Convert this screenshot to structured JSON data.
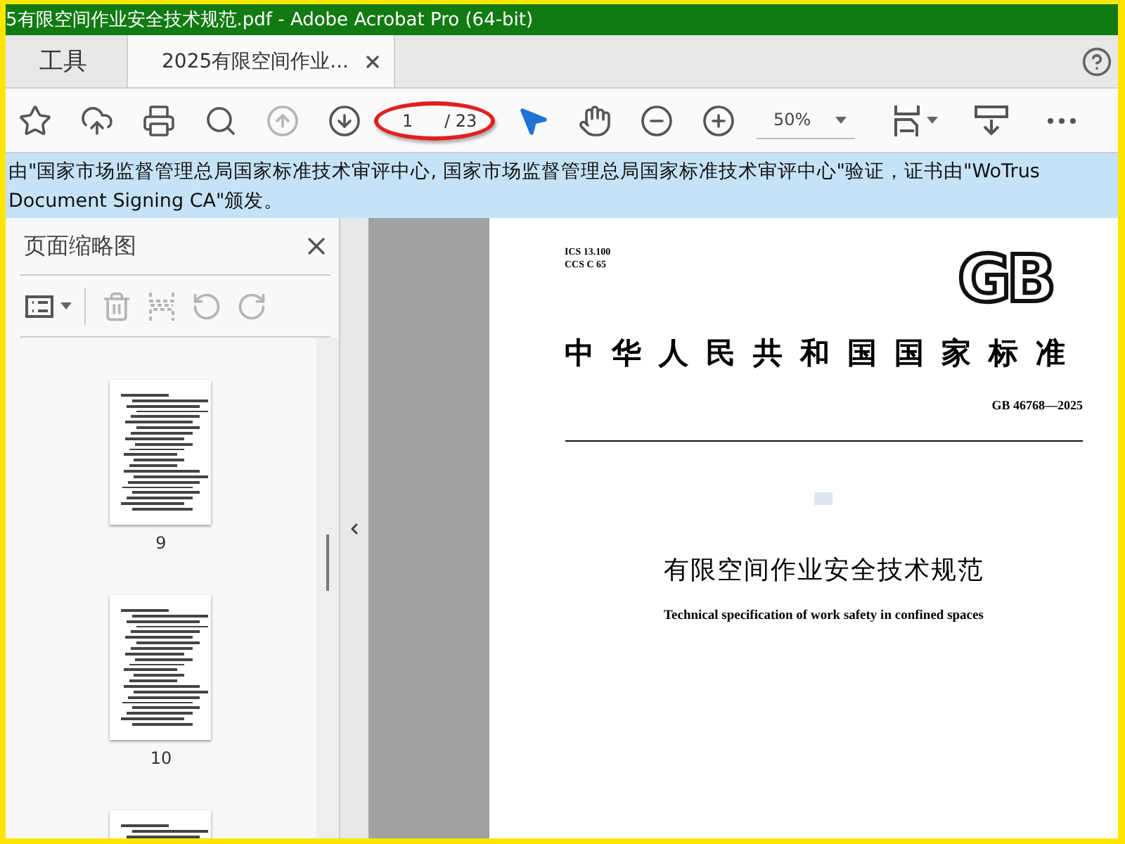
{
  "window": {
    "title": "5有限空间作业安全技术规范.pdf - Adobe Acrobat Pro (64-bit)"
  },
  "tabs": [
    {
      "label": "工具",
      "selected": false,
      "closable": false
    },
    {
      "label": "2025有限空间作业...",
      "selected": true,
      "closable": true
    }
  ],
  "toolbar": {
    "left": [
      {
        "kind": "star",
        "disabled": false
      },
      {
        "kind": "upload",
        "disabled": false
      },
      {
        "kind": "print",
        "disabled": false
      },
      {
        "kind": "search",
        "disabled": false
      },
      {
        "kind": "page-up",
        "disabled": true
      },
      {
        "kind": "page-down",
        "disabled": false
      }
    ],
    "page_field": {
      "value": "1",
      "total": "/ 23",
      "circled": true
    },
    "tools": [
      {
        "kind": "pointer",
        "selected": true
      },
      {
        "kind": "hand",
        "selected": false
      },
      {
        "kind": "zoom-out",
        "selected": false
      },
      {
        "kind": "zoom-in",
        "selected": false
      }
    ],
    "zoom": {
      "value": "50%"
    },
    "right": [
      {
        "kind": "fit",
        "disabled": false
      },
      {
        "kind": "scroll",
        "disabled": false
      },
      {
        "kind": "more",
        "disabled": false
      }
    ]
  },
  "notice": {
    "text": "由\"国家市场监督管理总局国家标准技术审评中心, 国家市场监督管理总局国家标准技术审评中心\"验证，证书由\"WoTrus Document Signing CA\"颁发。"
  },
  "thumbnail_panel": {
    "title": "页面缩略图",
    "tools": [
      {
        "kind": "options",
        "disabled": false
      },
      {
        "kind": "delete",
        "disabled": true
      },
      {
        "kind": "extract",
        "disabled": true
      },
      {
        "kind": "rotate-left",
        "disabled": true
      },
      {
        "kind": "rotate-right",
        "disabled": true
      }
    ],
    "thumbnails": [
      {
        "label": "9",
        "selected": false
      },
      {
        "label": "10",
        "selected": false
      },
      {
        "selected": false
      }
    ]
  },
  "document": {
    "ics": "ICS 13.100",
    "ccs": "CCS C 65",
    "logo": "GB",
    "heading": "中华人民共和国国家标准",
    "code": "GB 46768—2025",
    "title": "有限空间作业安全技术规范",
    "english_title": "Technical specification of work safety in confined spaces"
  }
}
